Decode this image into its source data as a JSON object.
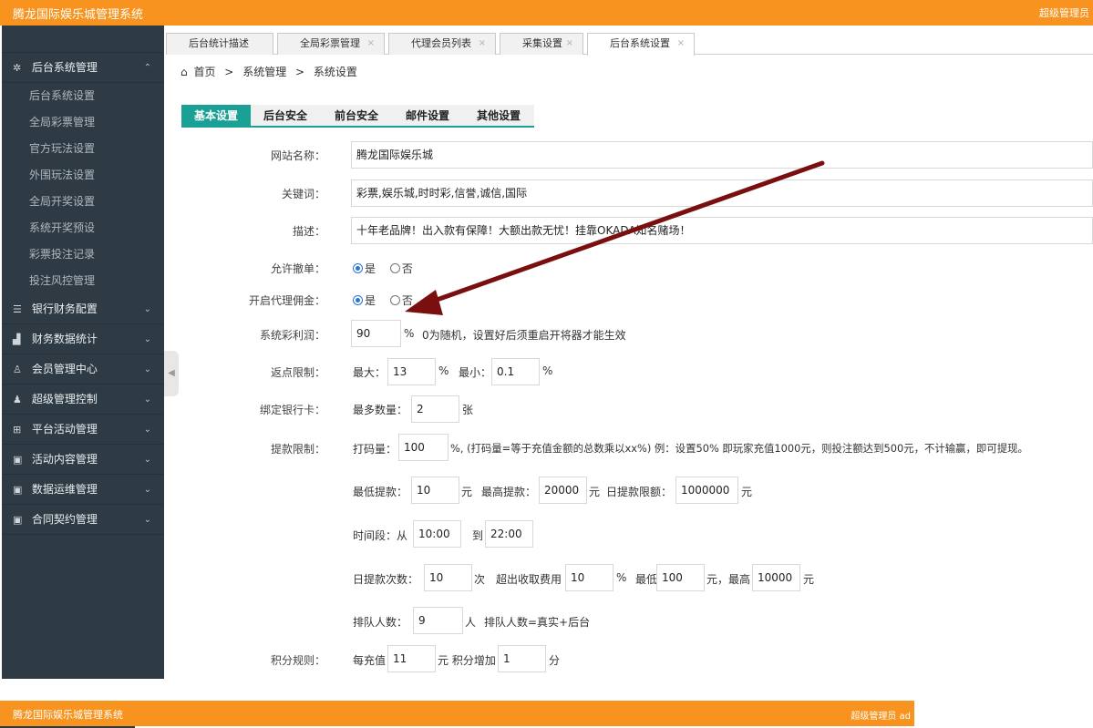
{
  "header": {
    "title": "腾龙国际娱乐城管理系统",
    "user": "超级管理员"
  },
  "sidebar": {
    "groups": [
      {
        "label": "后台系统管理",
        "icon": "gear-icon",
        "glyph": "✲",
        "chev": "⌃",
        "items": [
          "后台系统设置",
          "全局彩票管理",
          "官方玩法设置",
          "外围玩法设置",
          "全局开奖设置",
          "系统开奖预设",
          "彩票投注记录",
          "投注风控管理"
        ]
      },
      {
        "label": "银行财务配置",
        "icon": "list-icon",
        "glyph": "☰",
        "chev": "⌄"
      },
      {
        "label": "财务数据统计",
        "icon": "bar-chart-icon",
        "glyph": "▟",
        "chev": "⌄"
      },
      {
        "label": "会员管理中心",
        "icon": "user-icon",
        "glyph": "♙",
        "chev": "⌄"
      },
      {
        "label": "超级管理控制",
        "icon": "admin-icon",
        "glyph": "♟",
        "chev": "⌄"
      },
      {
        "label": "平台活动管理",
        "icon": "gift-icon",
        "glyph": "⊞",
        "chev": "⌄"
      },
      {
        "label": "活动内容管理",
        "icon": "book-icon",
        "glyph": "▣",
        "chev": "⌄"
      },
      {
        "label": "数据运维管理",
        "icon": "book-icon",
        "glyph": "▣",
        "chev": "⌄"
      },
      {
        "label": "合同契约管理",
        "icon": "book-icon",
        "glyph": "▣",
        "chev": "⌄"
      }
    ],
    "collapse_glyph": "◀"
  },
  "tabs": [
    "后台统计描述",
    "全局彩票管理",
    "代理会员列表",
    "采集设置",
    "后台系统设置"
  ],
  "tab_close": "×",
  "breadcrumb": {
    "home": "首页",
    "sep": ">",
    "level1": "系统管理",
    "level2": "系统设置"
  },
  "subtabs": [
    "基本设置",
    "后台安全",
    "前台安全",
    "邮件设置",
    "其他设置"
  ],
  "form": {
    "site_name": {
      "label": "网站名称：",
      "value": "腾龙国际娱乐城"
    },
    "keywords": {
      "label": "关键词：",
      "value": "彩票,娱乐城,时时彩,信誉,诚信,国际"
    },
    "description": {
      "label": "描述：",
      "value": "十年老品牌！出入款有保障！大额出款无忧！挂靠OKADA知名赌场！"
    },
    "allow_cancel": {
      "label": "允许撤单：",
      "yes": "是",
      "no": "否"
    },
    "agent_commission": {
      "label": "开启代理佣金：",
      "yes": "是",
      "no": "否"
    },
    "profit": {
      "label": "系统彩利润：",
      "value": "90",
      "unit": "%",
      "hint": "0为随机，设置好后须重启开将器才能生效"
    },
    "rebate": {
      "label": "返点限制：",
      "max_label": "最大：",
      "max": "13",
      "pct1": "%",
      "min_label": "最小：",
      "min": "0.1",
      "pct2": "%"
    },
    "bank": {
      "label": "绑定银行卡：",
      "max_label": "最多数量：",
      "max": "2",
      "unit": "张"
    },
    "withdraw": {
      "label": "提款限制：",
      "code_label": "打码量：",
      "code": "100",
      "code_hint": "%, (打码量=等于充值金额的总数乘以xx%) 例：设置50% 即玩家充值1000元，则投注额达到500元，不计输赢，即可提现。",
      "min_label": "最低提款：",
      "min": "10",
      "yuan1": "元",
      "max_label": "最高提款：",
      "max": "20000",
      "yuan2": "元",
      "daily_label": "日提款限额：",
      "daily": "1000000",
      "yuan3": "元",
      "time_label": "时间段：从",
      "time_from": "10:00",
      "time_to_label": "到",
      "time_to": "22:00",
      "times_label": "日提款次数：",
      "times": "10",
      "times_unit": "次",
      "fee_label": "超出收取费用",
      "fee": "10",
      "fee_pct": "%",
      "fee_min_label": "最低",
      "fee_min": "100",
      "fee_max_label": "元，最高",
      "fee_max": "10000",
      "fee_max_unit": "元",
      "queue_label": "排队人数：",
      "queue": "9",
      "queue_unit": "人",
      "queue_hint": "排队人数=真实+后台"
    },
    "points": {
      "label": "积分规则：",
      "per_label": "每充值",
      "per": "11",
      "mid": "元 积分增加",
      "gain": "1",
      "unit": "分"
    }
  },
  "footer": {
    "title": "腾龙国际娱乐城管理系统",
    "user": "超级管理员 ad"
  }
}
